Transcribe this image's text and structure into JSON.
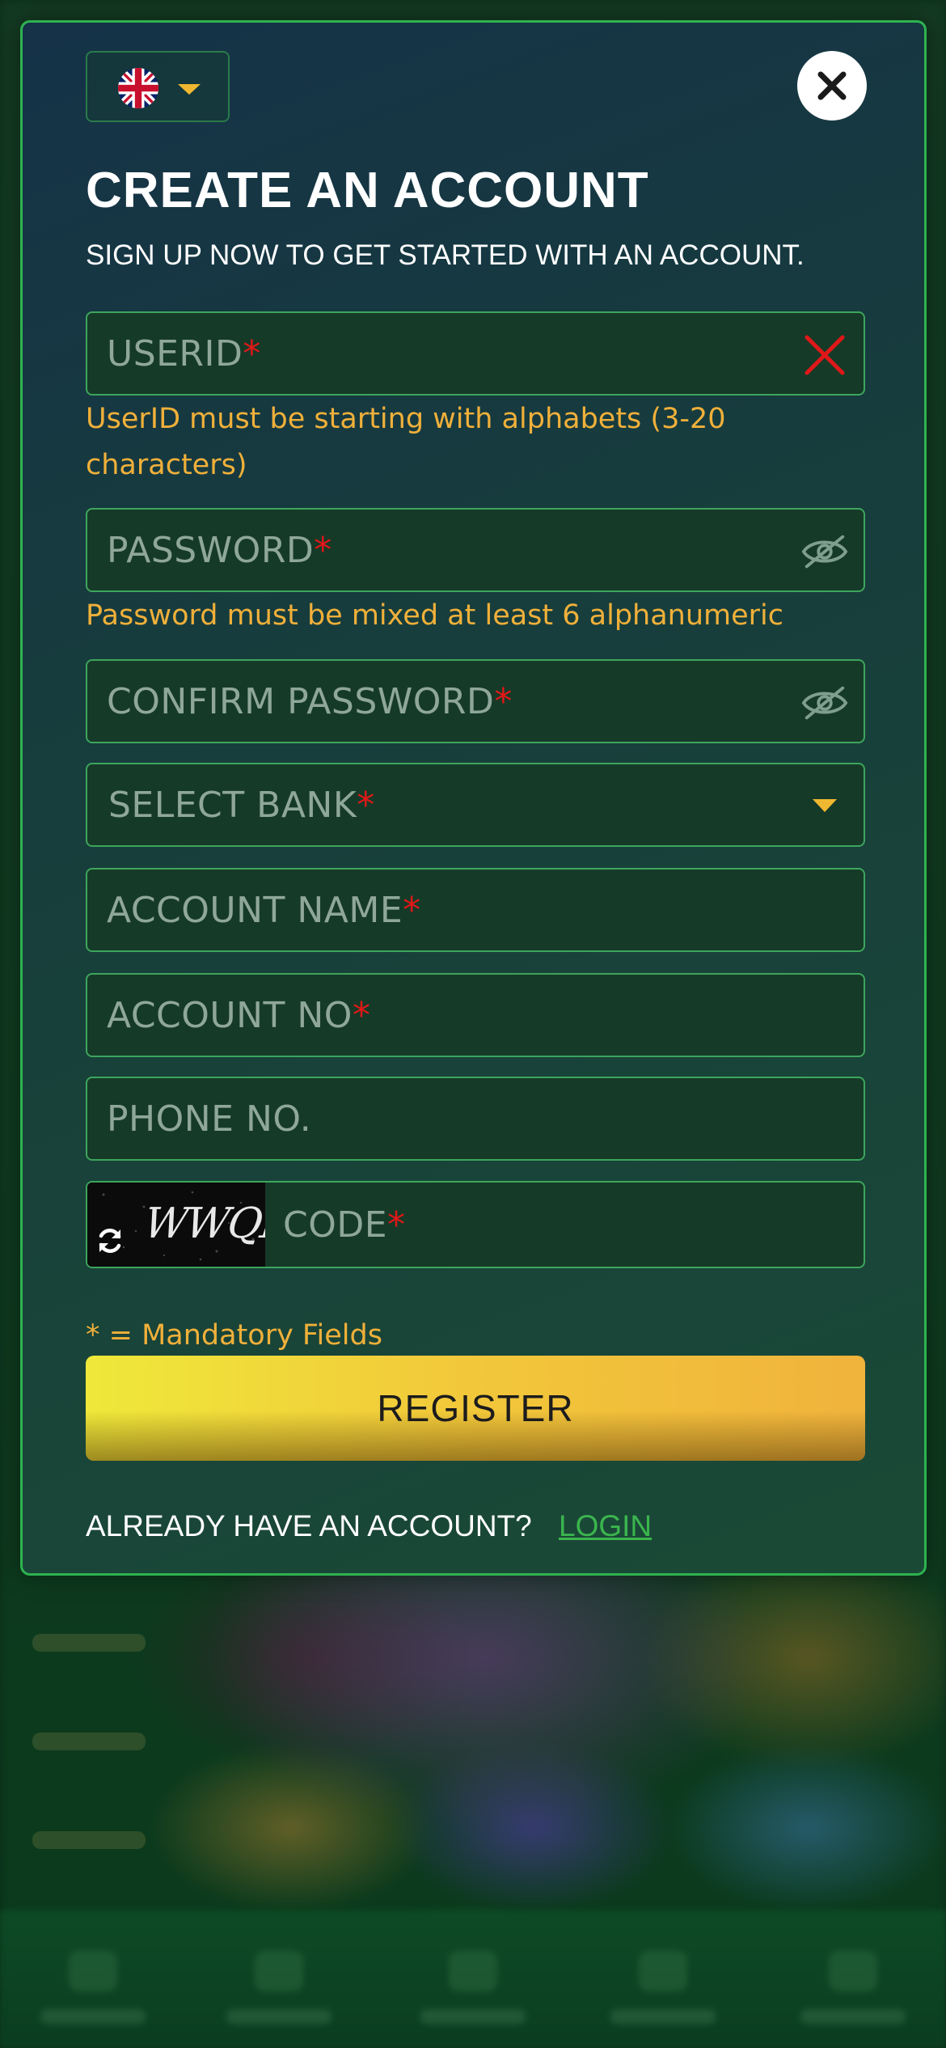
{
  "modal": {
    "title": "CREATE AN ACCOUNT",
    "subtitle": "SIGN UP NOW TO GET STARTED WITH AN ACCOUNT."
  },
  "language": {
    "selected": "English (UK)",
    "flag_icon": "uk-flag-icon"
  },
  "fields": {
    "userid": {
      "placeholder": "USERID",
      "value": "",
      "hint": "UserID must be starting with alphabets (3-20 characters)",
      "status_icon": "error-x-icon"
    },
    "password": {
      "placeholder": "PASSWORD",
      "value": "",
      "hint": "Password must be mixed at least 6 alphanumeric",
      "toggle_icon": "eye-slash-icon"
    },
    "confirm_password": {
      "placeholder": "CONFIRM PASSWORD",
      "value": "",
      "toggle_icon": "eye-slash-icon"
    },
    "bank": {
      "placeholder": "SELECT BANK",
      "value": ""
    },
    "account_name": {
      "placeholder": "ACCOUNT NAME",
      "value": ""
    },
    "account_no": {
      "placeholder": "ACCOUNT NO",
      "value": ""
    },
    "phone": {
      "placeholder": "PHONE NO.",
      "value": ""
    },
    "code": {
      "placeholder": "CODE",
      "value": "",
      "captcha_text": "WWQF"
    }
  },
  "required_marker": "*",
  "mandatory_note": "* = Mandatory Fields",
  "register_label": "REGISTER",
  "login_prompt": "ALREADY HAVE AN ACCOUNT?",
  "login_label": "LOGIN",
  "colors": {
    "accent_green": "#2eb350",
    "hint_orange": "#f0b03a",
    "required_red": "#e01818",
    "button_yellow": "#f2c73a"
  }
}
